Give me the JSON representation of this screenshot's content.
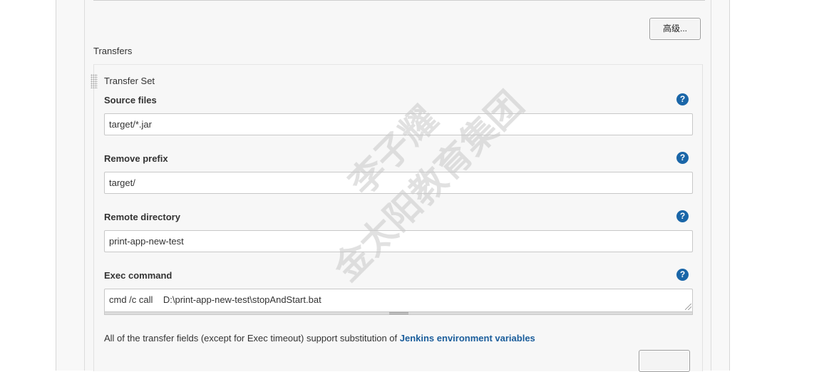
{
  "buttons": {
    "advanced_label": "高级...",
    "bottom_label": ""
  },
  "transfers": {
    "section_label": "Transfers",
    "set_title": "Transfer Set",
    "fields": {
      "source_files": {
        "label": "Source files",
        "value": "target/*.jar"
      },
      "remove_prefix": {
        "label": "Remove prefix",
        "value": "target/"
      },
      "remote_directory": {
        "label": "Remote directory",
        "value": "print-app-new-test"
      },
      "exec_command": {
        "label": "Exec command",
        "value": "cmd /c call    D:\\print-app-new-test\\stopAndStart.bat"
      }
    },
    "help_glyph": "?",
    "note_text": "All of the transfer fields (except for Exec timeout) support substitution of ",
    "note_link": "Jenkins environment variables"
  },
  "watermark": {
    "line1": "李子耀",
    "line2": "金太阳教育集团"
  },
  "colors": {
    "help_icon": "#1a66a8",
    "link": "#1a5d9b",
    "panel_bg": "#f7f7f7"
  },
  "icons": {
    "help": "help-icon",
    "drag": "drag-handle-icon"
  }
}
